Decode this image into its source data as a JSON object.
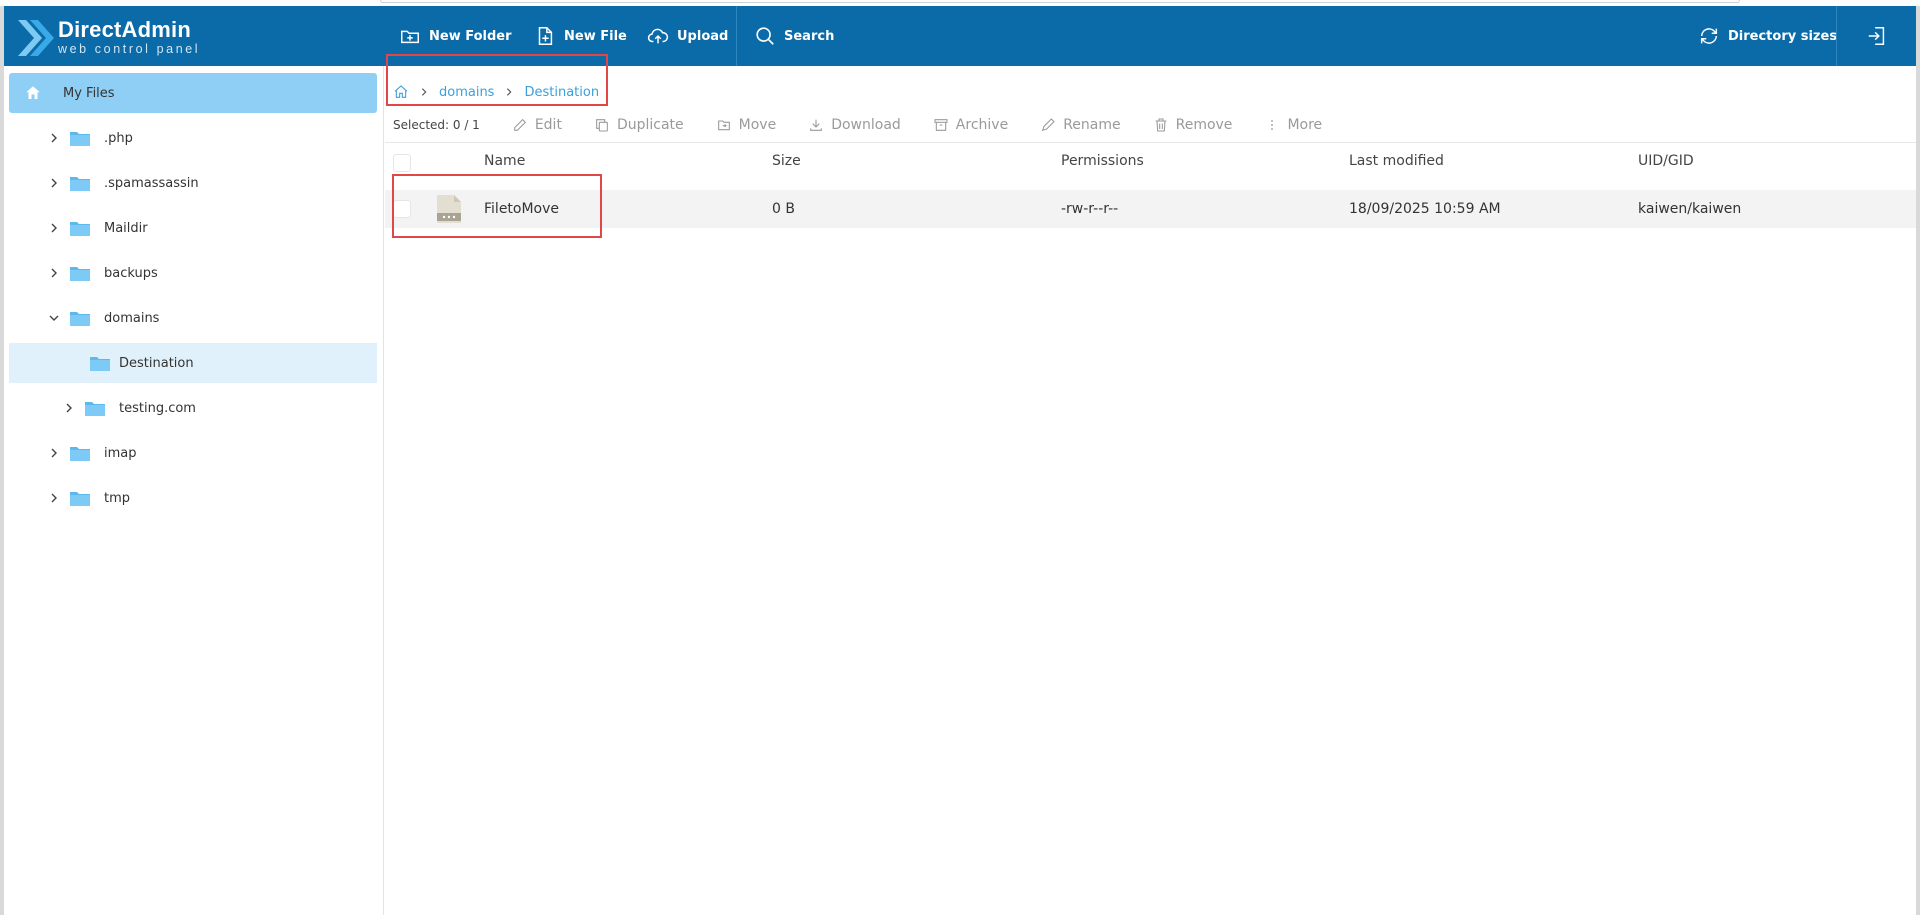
{
  "brand": {
    "name": "DirectAdmin",
    "tagline": "web control panel"
  },
  "toolbar": {
    "new_folder": "New Folder",
    "new_file": "New File",
    "upload": "Upload",
    "search": "Search",
    "directory_sizes": "Directory sizes"
  },
  "sidebar": {
    "root": "My Files",
    "items": [
      {
        "label": ".php"
      },
      {
        "label": ".spamassassin"
      },
      {
        "label": "Maildir"
      },
      {
        "label": "backups"
      },
      {
        "label": "domains"
      },
      {
        "label": "Destination"
      },
      {
        "label": "testing.com"
      },
      {
        "label": "imap"
      },
      {
        "label": "tmp"
      }
    ]
  },
  "breadcrumb": {
    "items": [
      "domains",
      "Destination"
    ]
  },
  "actions": {
    "selected": "Selected: 0 / 1",
    "edit": "Edit",
    "duplicate": "Duplicate",
    "move": "Move",
    "download": "Download",
    "archive": "Archive",
    "rename": "Rename",
    "remove": "Remove",
    "more": "More"
  },
  "table": {
    "columns": [
      "Name",
      "Size",
      "Permissions",
      "Last modified",
      "UID/GID"
    ],
    "rows": [
      {
        "name": "FiletoMove",
        "size": "0 B",
        "permissions": "-rw-r--r--",
        "modified": "18/09/2025 10:59 AM",
        "owner": "kaiwen/kaiwen"
      }
    ]
  },
  "colors": {
    "header_bg": "#0b6ba8",
    "sidebar_active": "#8fcff5",
    "link": "#3aa0dc",
    "highlight": "#e04848"
  }
}
